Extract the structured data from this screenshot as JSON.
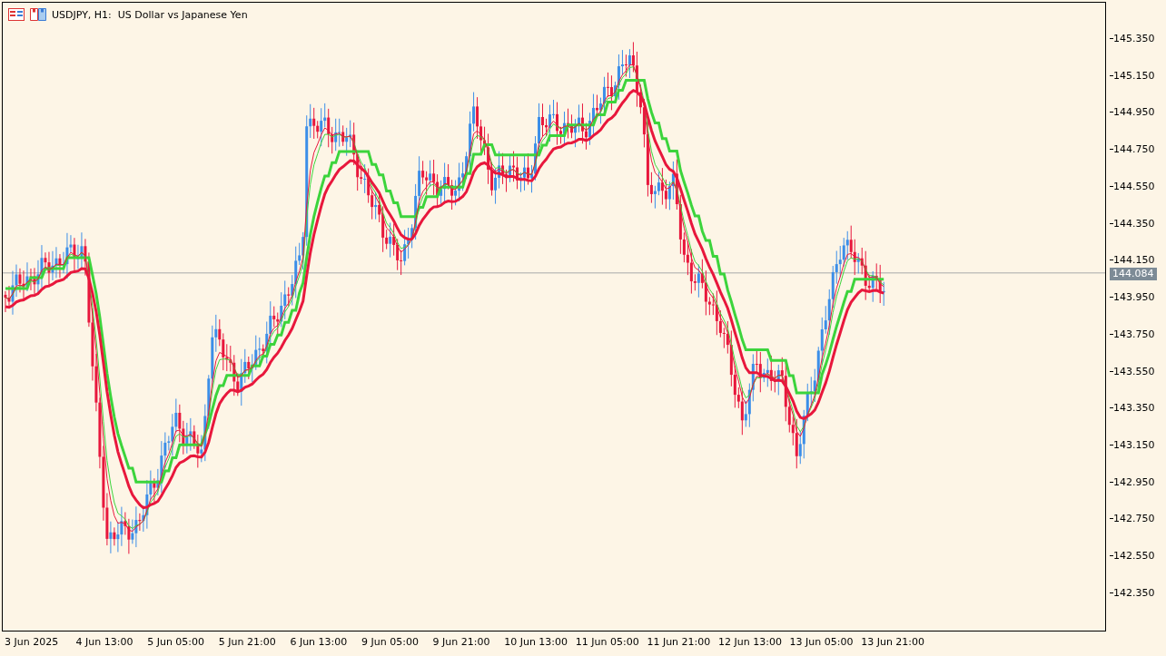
{
  "header": {
    "title": "USDJPY, H1:  US Dollar vs Japanese Yen"
  },
  "price_axis": {
    "ticks": [
      "145.350",
      "145.150",
      "144.950",
      "144.750",
      "144.550",
      "144.350",
      "144.150",
      "143.950",
      "143.750",
      "143.550",
      "143.350",
      "143.150",
      "142.950",
      "142.750",
      "142.550",
      "142.350"
    ]
  },
  "current_price": "144.084",
  "time_axis": {
    "ticks": [
      "3 Jun 2025",
      "4 Jun 13:00",
      "5 Jun 05:00",
      "5 Jun 21:00",
      "6 Jun 13:00",
      "9 Jun 05:00",
      "9 Jun 21:00",
      "10 Jun 13:00",
      "11 Jun 05:00",
      "11 Jun 21:00",
      "12 Jun 13:00",
      "13 Jun 05:00",
      "13 Jun 21:00"
    ]
  }
}
